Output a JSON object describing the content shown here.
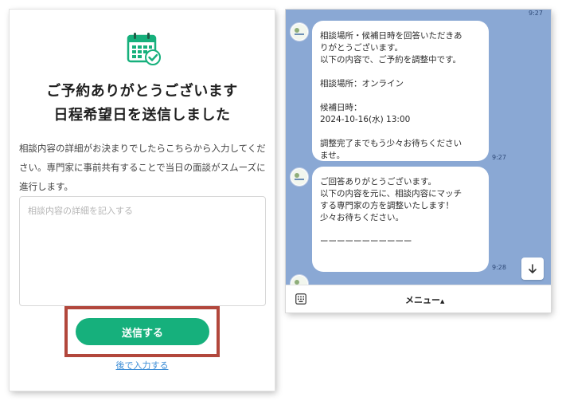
{
  "form": {
    "heading_line1": "ご予約ありがとうございます",
    "heading_line2": "日程希望日を送信しました",
    "description": "相談内容の詳細がお決まりでしたらこちらから入力してください。専門家に事前共有することで当日の面談がスムーズに進行します。",
    "details_placeholder": "相談内容の詳細を記入する",
    "submit_label": "送信する",
    "later_link": "後で入力する",
    "accent_color": "#16b07c",
    "highlight_color": "#b2473c"
  },
  "chat": {
    "top_time": "9:27",
    "messages": [
      {
        "lines": [
          "相談場所・候補日時を回答いただきあ",
          "りがとうございます。",
          "以下の内容で、ご予約を調整中です。",
          "",
          "相談場所：オンライン",
          "",
          "候補日時：",
          "2024-10-16(水) 13:00",
          "",
          "調整完了までもう少々お待ちください",
          "ませ。"
        ],
        "time": "9:27"
      },
      {
        "lines": [
          "ご回答ありがとうございます。",
          "以下の内容を元に、相談内容にマッチ",
          "する専門家の方を調整いたします！",
          "少々お待ちください。",
          "",
          "ーーーーーーーーーーー"
        ],
        "time": "9:28"
      }
    ],
    "menu_label": "メニュー",
    "menu_caret": "▲",
    "background_color": "#8aa8d4"
  }
}
